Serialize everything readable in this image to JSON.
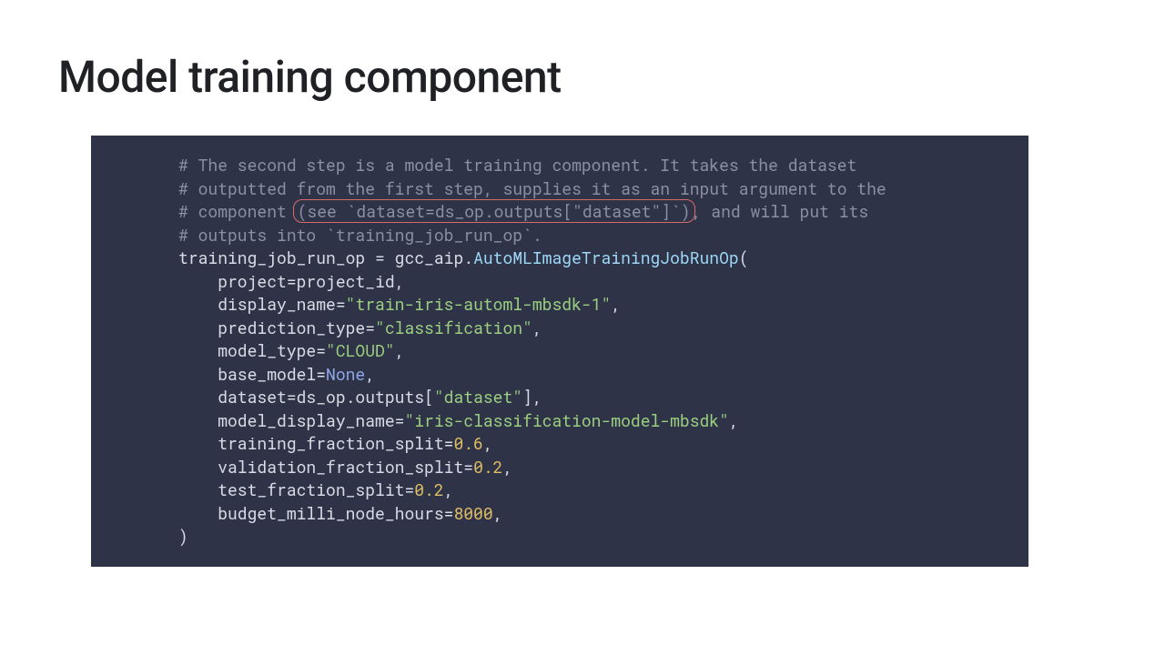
{
  "title": "Model training component",
  "code": {
    "comment1": "# The second step is a model training component. It takes the dataset",
    "comment2": "# outputted from the first step, supplies it as an input argument to the",
    "comment3a": "# component ",
    "highlight": "(see `dataset=ds_op.outputs[\"dataset\"]`)",
    "comment3b": ", and will put its",
    "comment4": "# outputs into `training_job_run_op`.",
    "assign_lhs": "training_job_run_op = gcc_aip.",
    "fn_name": "AutoMLImageTrainingJobRunOp",
    "paren_open": "(",
    "arg_project": "    project=project_id,",
    "arg_display_pre": "    display_name=",
    "arg_display_str": "\"train-iris-automl-mbsdk-1\"",
    "arg_display_post": ",",
    "arg_pred_pre": "    prediction_type=",
    "arg_pred_str": "\"classification\"",
    "arg_pred_post": ",",
    "arg_mtype_pre": "    model_type=",
    "arg_mtype_str": "\"CLOUD\"",
    "arg_mtype_post": ",",
    "arg_base_pre": "    base_model=",
    "arg_base_none": "None",
    "arg_base_post": ",",
    "arg_ds_pre": "    dataset=ds_op.outputs[",
    "arg_ds_str": "\"dataset\"",
    "arg_ds_post": "],",
    "arg_mdn_pre": "    model_display_name=",
    "arg_mdn_str": "\"iris-classification-model-mbsdk\"",
    "arg_mdn_post": ",",
    "arg_tf_pre": "    training_fraction_split=",
    "arg_tf_num": "0.6",
    "arg_tf_post": ",",
    "arg_vf_pre": "    validation_fraction_split=",
    "arg_vf_num": "0.2",
    "arg_vf_post": ",",
    "arg_tef_pre": "    test_fraction_split=",
    "arg_tef_num": "0.2",
    "arg_tef_post": ",",
    "arg_bud_pre": "    budget_milli_node_hours=",
    "arg_bud_num": "8000",
    "arg_bud_post": ",",
    "paren_close": ")"
  }
}
